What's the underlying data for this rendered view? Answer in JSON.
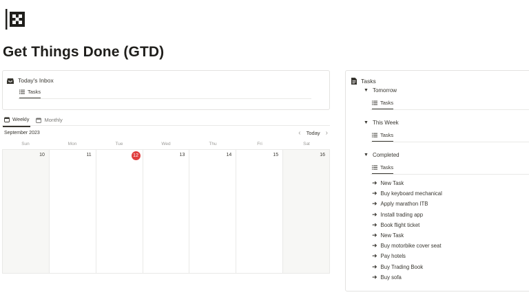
{
  "page": {
    "title": "Get Things Done (GTD)"
  },
  "inbox": {
    "title": "Today's Inbox",
    "view_tab": "Tasks"
  },
  "calendar": {
    "tabs": [
      {
        "label": "Weekly",
        "active": true
      },
      {
        "label": "Monthly",
        "active": false
      }
    ],
    "month": "September 2023",
    "today_label": "Today",
    "weekdays": [
      "Sun",
      "Mon",
      "Tue",
      "Wed",
      "Thu",
      "Fri",
      "Sat"
    ],
    "days": [
      "10",
      "11",
      "12",
      "13",
      "14",
      "15",
      "16"
    ],
    "today_day": "12",
    "today_color": "#e03e3e"
  },
  "tasks": {
    "title": "Tasks",
    "groups": [
      {
        "label": "Tomorrow",
        "view_tab": "Tasks"
      },
      {
        "label": "This Week",
        "view_tab": "Tasks"
      },
      {
        "label": "Completed",
        "view_tab": "Tasks"
      }
    ],
    "completed_items": [
      "New Task",
      "Buy keyboard mechanical",
      "Apply marathon ITB",
      "Install trading app",
      "Book flight ticket",
      "New Task",
      "Buy motorbike cover seat",
      "Pay hotels",
      "Buy Trading Book",
      "Buy sofa"
    ]
  }
}
